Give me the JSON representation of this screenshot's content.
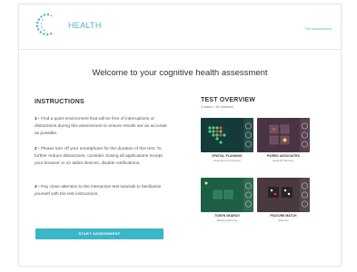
{
  "header": {
    "brand": "HEALTH",
    "link": "Get Assessment"
  },
  "welcome_title": "Welcome to your cognitive health assessment",
  "instructions": {
    "title": "INSTRUCTIONS",
    "steps": [
      {
        "num": "1 -",
        "text": "Find a quiet environment that will be free of interruptions or distractions during this assessment to ensure results are as accurate as possible."
      },
      {
        "num": "2 -",
        "text": "Please turn off your smartphone for the duration of this test. To further reduce distractions, consider closing all applications except your browser or on tablet devices, disable notifications."
      },
      {
        "num": "3 -",
        "text": "Pay close attention to the interactive test tutorials to familiarize yourself with the test instructions."
      }
    ],
    "start_button": "START ASSESSMENT"
  },
  "overview": {
    "title": "TEST OVERVIEW",
    "subtitle": "4 tasks / 15 minutes",
    "tests": [
      {
        "title": "SPATIAL PLANNING",
        "subtitle": "Executive Functioning"
      },
      {
        "title": "PAIRED ASSOCIATES",
        "subtitle": "Episodic Memory"
      },
      {
        "title": "TOKEN SEARCH",
        "subtitle": "Working Memory"
      },
      {
        "title": "FEATURE MATCH",
        "subtitle": "Attention"
      }
    ]
  },
  "colors": {
    "accent": "#3bb5c8",
    "card1_bg": "#143b39",
    "card2_bg": "#4a3342",
    "card3_bg": "#1e5e45",
    "card4_bg": "#4a3a3d"
  }
}
